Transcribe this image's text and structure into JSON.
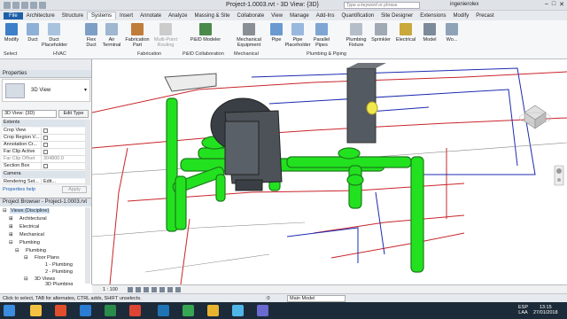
{
  "title": "Project-1.0003.rvt - 3D View: {3D}",
  "search_placeholder": "Type a keyword or phrase",
  "user": "ingenierolex",
  "tabs": [
    "File",
    "Architecture",
    "Structure",
    "Systems",
    "Insert",
    "Annotate",
    "Analyze",
    "Massing & Site",
    "Collaborate",
    "View",
    "Manage",
    "Add-Ins",
    "Quantification",
    "Site Designer",
    "Extensions",
    "Modify",
    "Precast"
  ],
  "active_tab": "Systems",
  "ribbon": {
    "buttons": [
      "Modify",
      "Duct",
      "Duct Placeholder",
      "Flex Duct",
      "Air Terminal",
      "Fabrication Part",
      "Multi-Point Routing",
      "P&ID Modeler",
      "Mechanical Equipment",
      "Pipe",
      "Pipe Placeholder",
      "Parallel Pipes",
      "Plumbing Fixture",
      "Sprinkler",
      "Electrical",
      "Model",
      "Wo..."
    ],
    "panels": [
      "Select",
      "HVAC",
      "Fabrication",
      "P&ID Collaboration",
      "Mechanical",
      "Plumbing & Piping"
    ]
  },
  "properties": {
    "header": "Properties",
    "type_name": "3D View",
    "view_selector": "3D View: {3D}",
    "edit_type": "Edit Type",
    "group_extents": "Extents",
    "rows": [
      {
        "k": "Crop View",
        "v": ""
      },
      {
        "k": "Crop Region V...",
        "v": ""
      },
      {
        "k": "Annotation Cr...",
        "v": ""
      },
      {
        "k": "Far Clip Active",
        "v": ""
      },
      {
        "k": "Far Clip Offset",
        "v": "304800.0"
      },
      {
        "k": "Section Box",
        "v": ""
      }
    ],
    "group_camera": "Camera",
    "rendering": "Rendering Set...",
    "rendering_edit": "Edit...",
    "help": "Properties help",
    "apply": "Apply"
  },
  "browser": {
    "header": "Project Browser - Project-1.0003.rvt",
    "items": [
      "Views (Discipline)",
      "Architectural",
      "Electrical",
      "Mechanical",
      "Plumbing",
      "Plumbing",
      "Floor Plans",
      "1 - Plumbing",
      "2 - Plumbing",
      "3D Views",
      "3D Plumbing"
    ]
  },
  "viewbar": {
    "scale": "1 : 100"
  },
  "status": {
    "hint": "Click to select, TAB for alternates, CTRL adds, SHIFT unselects.",
    "zero": ":0",
    "model": "Main Model"
  },
  "taskbar": {
    "lang": "ESP",
    "region": "LAA",
    "time": "13:15",
    "date": "27/01/2018"
  },
  "colors": {
    "pipe": "#22e21f",
    "file_tab": "#1f5fa8",
    "equipment": "#555a60"
  }
}
